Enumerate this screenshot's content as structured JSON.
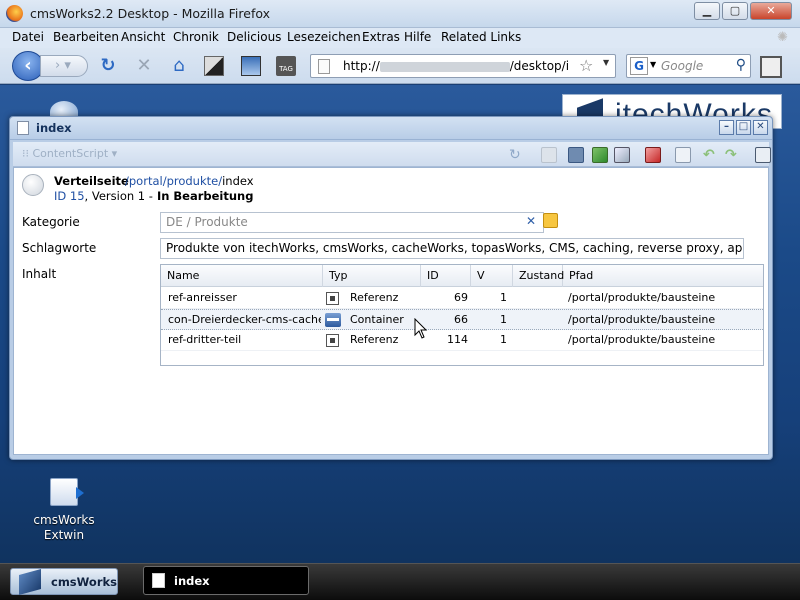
{
  "browser": {
    "title": "cmsWorks2.2 Desktop - Mozilla Firefox",
    "menu": [
      "Datei",
      "Bearbeiten",
      "Ansicht",
      "Chronik",
      "Delicious",
      "Lesezeichen",
      "Extras",
      "Hilfe",
      "Related Links"
    ],
    "url_prefix": "http://",
    "url_suffix": "/desktop/i",
    "search_placeholder": "Google",
    "search_engine_letter": "G",
    "tag_label": "TAG"
  },
  "desktop": {
    "brand": "itechWorks",
    "icon_label_1": "cmsWorks",
    "icon_label_2": "Extwin"
  },
  "window": {
    "title": "index",
    "content_script_label": "ContentScript",
    "page_type": "Verteilseite",
    "page_path_link": "/portal/produkte/",
    "page_path_tail": "index",
    "id_label": "ID 15",
    "version_label": ", Version 1  -",
    "status": "In Bearbeitung"
  },
  "form": {
    "kategorie_label": "Kategorie",
    "kategorie_value": "DE / Produkte",
    "schlagworte_label": "Schlagworte",
    "schlagworte_value": "Produkte von itechWorks, cmsWorks, cacheWorks, topasWorks, CMS, caching, reverse proxy, application",
    "inhalt_label": "Inhalt"
  },
  "table": {
    "columns": [
      "Name",
      "Typ",
      "ID",
      "V",
      "Zustand",
      "Pfad"
    ],
    "rows": [
      {
        "name": "ref-anreisser",
        "type": "Referenz",
        "id": "69",
        "v": "1",
        "zustand": "",
        "pfad": "/portal/produkte/bausteine"
      },
      {
        "name": "con-Dreierdecker-cms-cache-to",
        "type": "Container",
        "id": "66",
        "v": "1",
        "zustand": "",
        "pfad": "/portal/produkte/bausteine"
      },
      {
        "name": "ref-dritter-teil",
        "type": "Referenz",
        "id": "114",
        "v": "1",
        "zustand": "",
        "pfad": "/portal/produkte/bausteine"
      }
    ]
  },
  "taskbar": {
    "start_label": "cmsWorks",
    "task_label": "index"
  }
}
